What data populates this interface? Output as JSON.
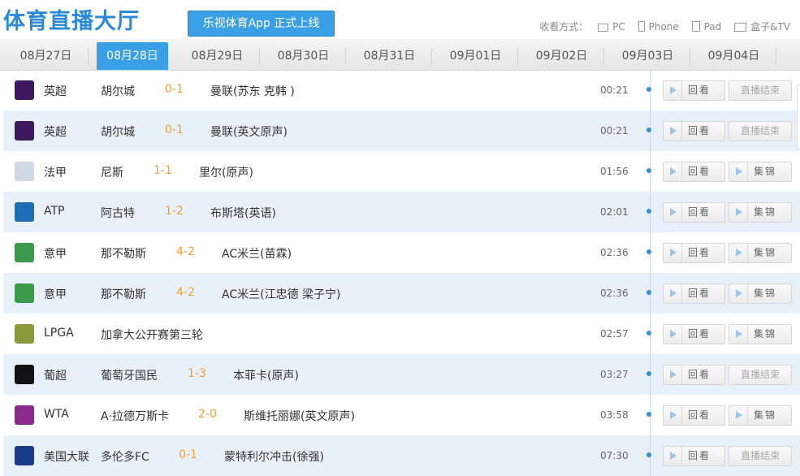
{
  "header": {
    "site_title": "体育直播大厅",
    "app_banner": "乐视体育App 正式上线",
    "watch_ways_label": "收看方式：",
    "devices": [
      {
        "name": "PC",
        "icon": "pc-icon"
      },
      {
        "name": "Phone",
        "icon": "phone-icon"
      },
      {
        "name": "Pad",
        "icon": "pad-icon"
      },
      {
        "name": "盒子&TV",
        "icon": "tv-icon"
      }
    ]
  },
  "dates": [
    {
      "label": "08月27日",
      "active": false
    },
    {
      "label": "08月28日",
      "active": true
    },
    {
      "label": "08月29日",
      "active": false
    },
    {
      "label": "08月30日",
      "active": false
    },
    {
      "label": "08月31日",
      "active": false
    },
    {
      "label": "09月01日",
      "active": false
    },
    {
      "label": "09月02日",
      "active": false
    },
    {
      "label": "09月03日",
      "active": false
    },
    {
      "label": "09月04日",
      "active": false
    }
  ],
  "buttons": {
    "replay": "回看",
    "highlights": "集锦",
    "ended": "直播结束"
  },
  "matches": [
    {
      "league": "英超",
      "logo": "premier-league-icon",
      "logo_color": "#3d185c",
      "home": "胡尔城",
      "score": "0-1",
      "away": "曼联(苏东 克韩 )",
      "time": "00:21",
      "second_button": "ended"
    },
    {
      "league": "英超",
      "logo": "premier-league-icon",
      "logo_color": "#3d185c",
      "home": "胡尔城",
      "score": "0-1",
      "away": "曼联(英文原声)",
      "time": "00:21",
      "second_button": "ended"
    },
    {
      "league": "法甲",
      "logo": "ligue1-icon",
      "logo_color": "#cfd8e3",
      "home": "尼斯",
      "score": "1-1",
      "away": "里尔(原声)",
      "time": "01:56",
      "second_button": "highlights"
    },
    {
      "league": "ATP",
      "logo": "atp-icon",
      "logo_color": "#1e6db5",
      "home": "阿古特",
      "score": "1-2",
      "away": "布斯塔(英语)",
      "time": "02:01",
      "second_button": "highlights"
    },
    {
      "league": "意甲",
      "logo": "serie-a-icon",
      "logo_color": "#3a9a4a",
      "home": "那不勒斯",
      "score": "4-2",
      "away": "AC米兰(苗霖)",
      "time": "02:36",
      "second_button": "highlights"
    },
    {
      "league": "意甲",
      "logo": "serie-a-icon",
      "logo_color": "#3a9a4a",
      "home": "那不勒斯",
      "score": "4-2",
      "away": "AC米兰(江忠德 梁子宁)",
      "time": "02:36",
      "second_button": "highlights"
    },
    {
      "league": "LPGA",
      "logo": "lpga-icon",
      "logo_color": "#8a9a3a",
      "home": "加拿大公开赛第三轮",
      "score": "",
      "away": "",
      "time": "02:57",
      "second_button": "highlights"
    },
    {
      "league": "葡超",
      "logo": "liga-portugal-icon",
      "logo_color": "#111111",
      "home": "葡萄牙国民",
      "score": "1-3",
      "away": "本菲卡(原声)",
      "time": "03:27",
      "second_button": "ended"
    },
    {
      "league": "WTA",
      "logo": "wta-icon",
      "logo_color": "#8a2a8a",
      "home": "A·拉德万斯卡",
      "score": "2-0",
      "away": "斯维托丽娜(英文原声)",
      "time": "03:58",
      "second_button": "highlights"
    },
    {
      "league": "美国大联",
      "logo": "mls-icon",
      "logo_color": "#1a3a8a",
      "home": "多伦多FC",
      "score": "0-1",
      "away": "蒙特利尔冲击(徐强)",
      "time": "07:30",
      "second_button": "ended"
    }
  ]
}
